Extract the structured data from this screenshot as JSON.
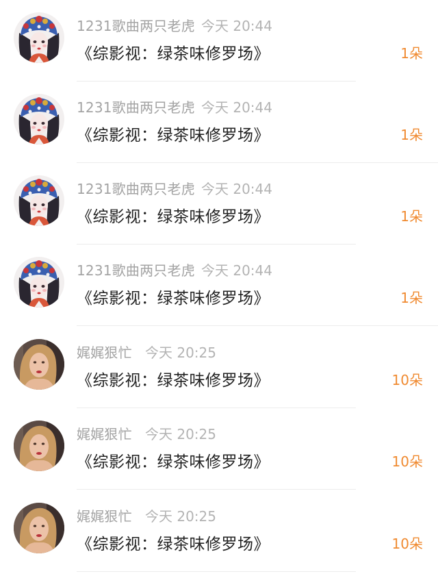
{
  "messages": [
    {
      "user": "1231歌曲两只老虎",
      "time": "今天 20:44",
      "title": "《综影视：绿茶味修罗场》",
      "count": "1朵",
      "avatar": "opera-avatar"
    },
    {
      "user": "1231歌曲两只老虎",
      "time": "今天 20:44",
      "title": "《综影视：绿茶味修罗场》",
      "count": "1朵",
      "avatar": "opera-avatar"
    },
    {
      "user": "1231歌曲两只老虎",
      "time": "今天 20:44",
      "title": "《综影视：绿茶味修罗场》",
      "count": "1朵",
      "avatar": "opera-avatar"
    },
    {
      "user": "1231歌曲两只老虎",
      "time": "今天 20:44",
      "title": "《综影视：绿茶味修罗场》",
      "count": "1朵",
      "avatar": "opera-avatar"
    },
    {
      "user": "娓娓狠忙",
      "time": "今天 20:25",
      "title": "《综影视：绿茶味修罗场》",
      "count": "10朵",
      "avatar": "woman-avatar"
    },
    {
      "user": "娓娓狠忙",
      "time": "今天 20:25",
      "title": "《综影视：绿茶味修罗场》",
      "count": "10朵",
      "avatar": "woman-avatar"
    },
    {
      "user": "娓娓狠忙",
      "time": "今天 20:25",
      "title": "《综影视：绿茶味修罗场》",
      "count": "10朵",
      "avatar": "woman-avatar"
    }
  ],
  "colors": {
    "username": "#a3a3a3",
    "time": "#b3b3b3",
    "title": "#222222",
    "count": "#f08a30",
    "divider": "#ececec"
  }
}
